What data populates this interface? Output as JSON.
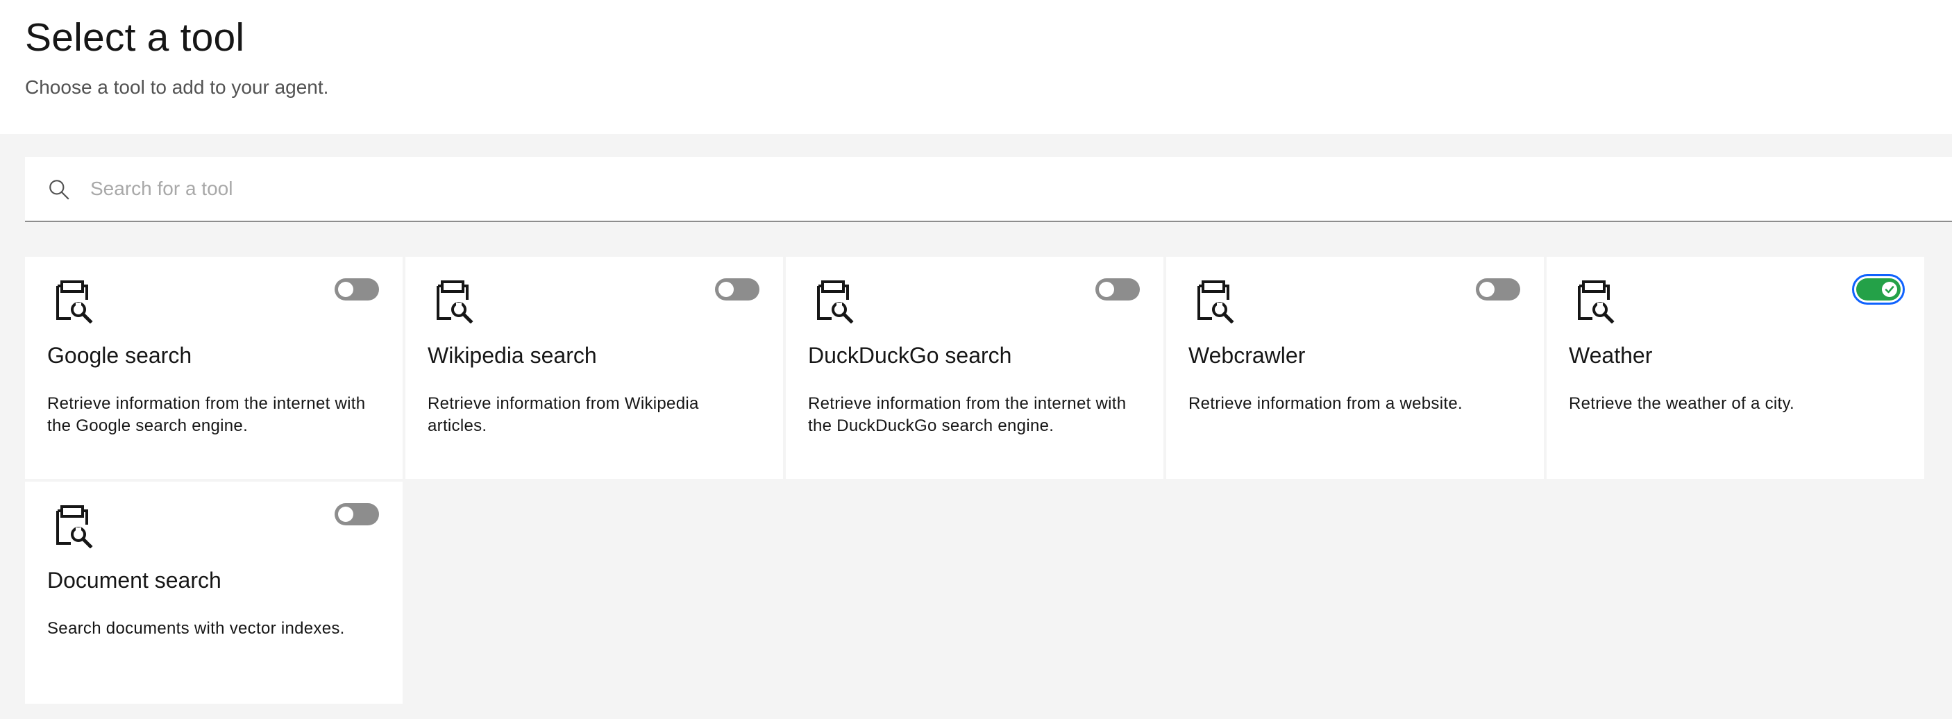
{
  "header": {
    "title": "Select a tool",
    "subtitle": "Choose a tool to add to your agent."
  },
  "search": {
    "placeholder": "Search for a tool",
    "value": ""
  },
  "tools": [
    {
      "name": "Google search",
      "description": "Retrieve information from the internet with the Google search engine.",
      "enabled": false
    },
    {
      "name": "Wikipedia search",
      "description": "Retrieve information from Wikipedia articles.",
      "enabled": false
    },
    {
      "name": "DuckDuckGo search",
      "description": "Retrieve information from the internet with the DuckDuckGo search engine.",
      "enabled": false
    },
    {
      "name": "Webcrawler",
      "description": "Retrieve information from a website.",
      "enabled": false
    },
    {
      "name": "Weather",
      "description": "Retrieve the weather of a city.",
      "enabled": true
    },
    {
      "name": "Document search",
      "description": "Search documents with vector indexes.",
      "enabled": false
    }
  ],
  "icons": {
    "search": "search-icon",
    "tool": "clipboard-wrench-icon",
    "toggle_checked": "checkmark-icon"
  },
  "colors": {
    "toggle_off": "#8d8d8d",
    "toggle_on": "#24a148",
    "focus": "#0f62fe",
    "background": "#f4f4f4",
    "card": "#ffffff"
  }
}
